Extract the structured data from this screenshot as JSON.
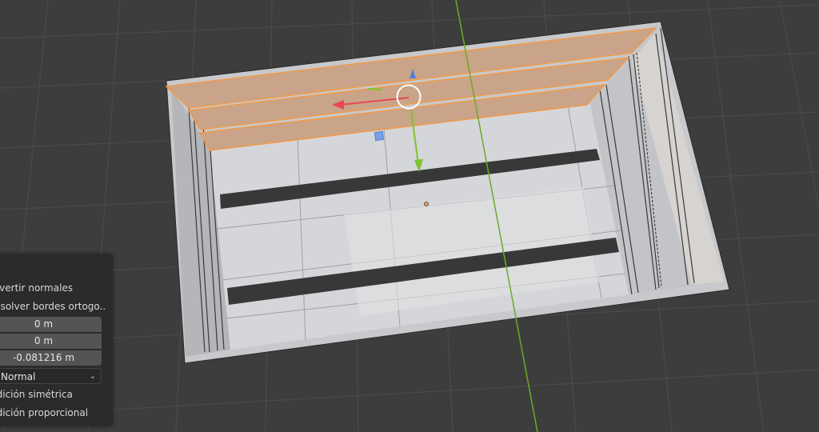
{
  "viewport": {
    "background": "#3d3d3d",
    "grid_color": "#4a4a4a",
    "y_axis_color": "#6ea82a",
    "selection_color": "#f29a4a"
  },
  "gizmo": {
    "x_axis_color": "#e8484f",
    "y_axis_color": "#7ec42a",
    "z_axis_color": "#4f7fd6"
  },
  "operator_panel": {
    "invert_normals_label": "Invertir normales",
    "dissolve_ortho_label": "Disolver bordes ortogo...",
    "move_x": "0 m",
    "move_y": "0 m",
    "move_z": "-0.081216 m",
    "orientation": "Normal",
    "symmetric_edit_label": "Edición simétrica",
    "proportional_edit_label": "Edición proporcional",
    "icons": {
      "orientation_dropdown": "chevron-down-icon"
    }
  }
}
